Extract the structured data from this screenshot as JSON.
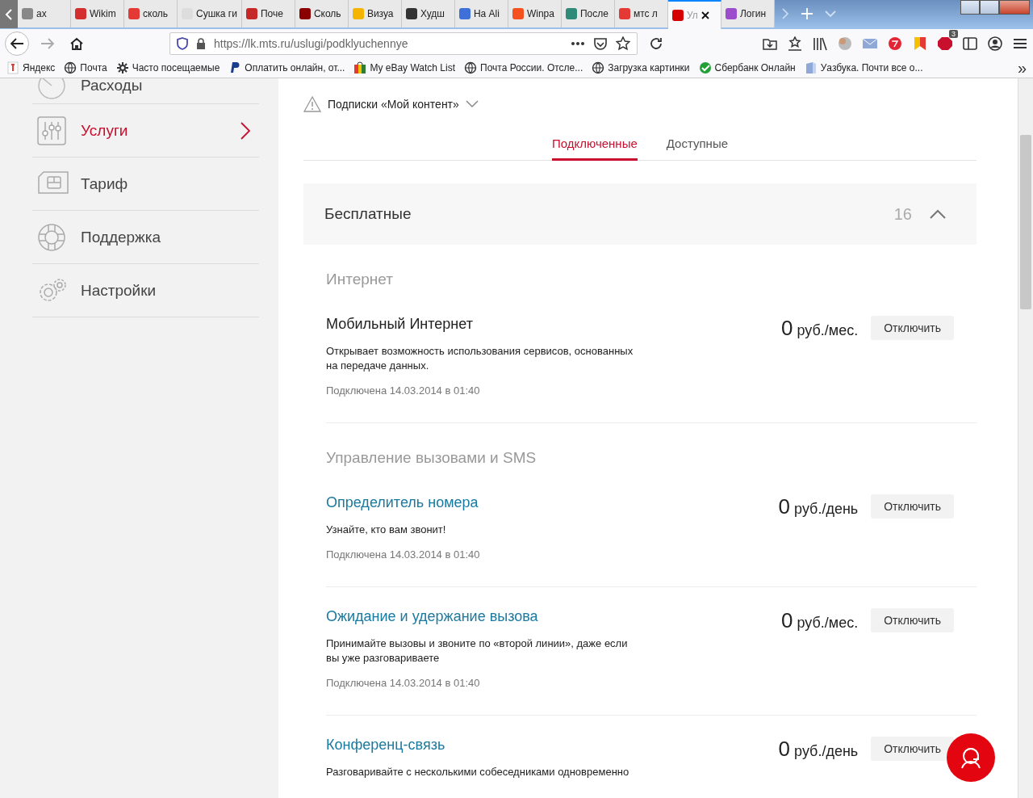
{
  "browser": {
    "tabs": [
      {
        "title": "ах",
        "color": "#888888",
        "selected": false
      },
      {
        "title": "Wikim",
        "color": "#d32f2f",
        "selected": false
      },
      {
        "title": "сколь",
        "color": "#e53935",
        "selected": false
      },
      {
        "title": "Сушка ги",
        "color": "#dddddd",
        "selected": false
      },
      {
        "title": "Поче",
        "color": "#c62828",
        "selected": false
      },
      {
        "title": "Сколь",
        "color": "#8b0000",
        "selected": false
      },
      {
        "title": "Визуа",
        "color": "#f4b400",
        "selected": false
      },
      {
        "title": "Худш",
        "color": "#333333",
        "selected": false
      },
      {
        "title": "На Ali",
        "color": "#3f6fd8",
        "selected": false
      },
      {
        "title": "Winpa",
        "color": "#f4511e",
        "selected": false
      },
      {
        "title": "После",
        "color": "#2e8b7a",
        "selected": false
      },
      {
        "title": "мтс л",
        "color": "#e53935",
        "selected": false
      },
      {
        "title": "Ул",
        "color": "#d50000",
        "selected": true
      },
      {
        "title": "Логин",
        "color": "#9c4dcc",
        "selected": false
      }
    ],
    "url": "https://lk.mts.ru/uslugi/podklyuchennye",
    "toolbar_badge": "3",
    "bookmarks": [
      "Яндекс",
      "Почта",
      "Часто посещаемые",
      "Оплатить онлайн, от...",
      "My eBay Watch List",
      "Почта России. Отсле...",
      "Загрузка картинки",
      "Сбербанк Онлайн",
      "Уазбука. Почти все о..."
    ],
    "bookmarks_more": "»"
  },
  "sidebar": {
    "items": [
      {
        "label": "Расходы",
        "selected": false
      },
      {
        "label": "Услуги",
        "selected": true
      },
      {
        "label": "Тариф",
        "selected": false
      },
      {
        "label": "Поддержка",
        "selected": false
      },
      {
        "label": "Настройки",
        "selected": false
      }
    ]
  },
  "subscriptions": {
    "label": "Подписки «Мой контент»"
  },
  "tabs": [
    {
      "label": "Подключенные",
      "selected": true
    },
    {
      "label": "Доступные",
      "selected": false
    }
  ],
  "section": {
    "title": "Бесплатные",
    "count": "16",
    "expanded": true
  },
  "groups": [
    {
      "title": "Интернет",
      "services": [
        {
          "name": "Мобильный Интернет",
          "link": false,
          "price": "0",
          "unit": "руб./мес.",
          "button": "Отключить",
          "description": "Открывает возможность использования сервисов, основанных на передаче данных.",
          "connected": "Подключена 14.03.2014 в 01:40"
        }
      ]
    },
    {
      "title": "Управление вызовами и SMS",
      "services": [
        {
          "name": "Определитель номера",
          "link": true,
          "price": "0",
          "unit": "руб./день",
          "button": "Отключить",
          "description": "Узнайте, кто вам звонит!",
          "connected": "Подключена 14.03.2014 в 01:40"
        },
        {
          "name": "Ожидание и удержание вызова",
          "link": true,
          "price": "0",
          "unit": "руб./мес.",
          "button": "Отключить",
          "description": "Принимайте вызовы и звоните по «второй линии», даже если вы уже разговариваете",
          "connected": "Подключена 14.03.2014 в 01:40"
        },
        {
          "name": "Конференц-связь",
          "link": true,
          "price": "0",
          "unit": "руб./день",
          "button": "Отключить",
          "description": "Разговаривайте с несколькими собеседниками одновременно"
        }
      ]
    }
  ]
}
